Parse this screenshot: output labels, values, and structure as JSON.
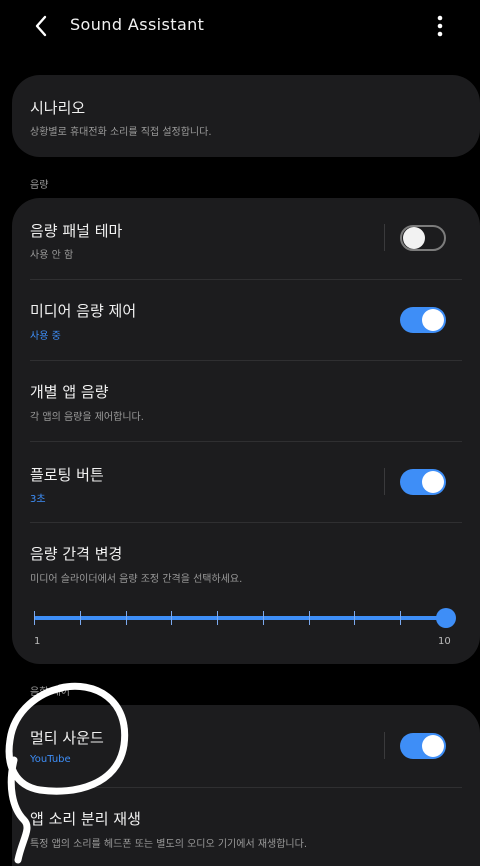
{
  "appbar": {
    "title": "Sound Assistant",
    "back_icon": "back-arrow-icon",
    "more_icon": "more-vertical-icon"
  },
  "scenario": {
    "title": "시나리오",
    "subtitle": "상황별로 휴대전화 소리를 직접 설정합니다."
  },
  "volume_section": {
    "label": "음량",
    "items": [
      {
        "title": "음량 패널 테마",
        "subtitle": "사용 안 함",
        "toggle": false
      },
      {
        "title": "미디어 음량 제어",
        "subtitle": "사용 중",
        "toggle": true
      },
      {
        "title": "개별 앱 음량",
        "subtitle": "각 앱의 음량을 제어합니다."
      },
      {
        "title": "플로팅 버튼",
        "subtitle": "3초",
        "toggle": true
      },
      {
        "title": "음량 간격 변경",
        "subtitle": "미디어 슬라이더에서 음량 조정 간격을 선택하세요."
      }
    ],
    "slider": {
      "min_label": "1",
      "max_label": "10",
      "value": 10,
      "min": 1,
      "max": 10
    }
  },
  "app_section": {
    "label": "음향 제어",
    "items": [
      {
        "title": "멀티 사운드",
        "subtitle": "YouTube",
        "toggle": true
      },
      {
        "title": "앱 소리 분리 재생",
        "subtitle": "특정 앱의 소리를 헤드폰 또는 별도의 오디오 기기에서 재생합니다."
      }
    ]
  },
  "colors": {
    "accent": "#3e8ef7",
    "card": "#1c1c1e",
    "background": "#000000"
  }
}
